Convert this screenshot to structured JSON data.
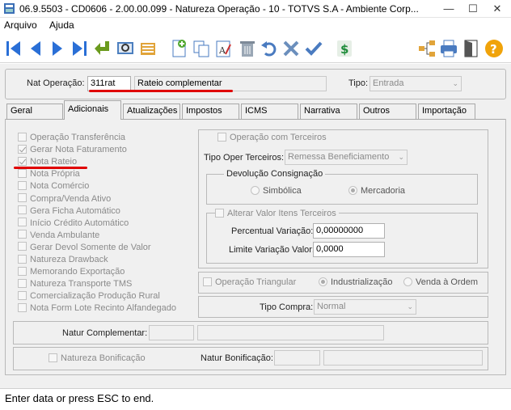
{
  "window": {
    "title": "06.9.5503 - CD0606 - 2.00.00.099 - Natureza Operação - 10 - TOTVS S.A - Ambiente Corp...",
    "minimize": "—",
    "maximize": "☐",
    "close": "✕"
  },
  "menu": {
    "items": [
      "Arquivo",
      "Ajuda"
    ]
  },
  "toolbar": {
    "icons": [
      "first-icon",
      "prev-icon",
      "next-icon",
      "last-icon",
      "goto-icon",
      "search-icon",
      "list-icon",
      "add-icon",
      "copy-icon",
      "edit-icon",
      "delete-icon",
      "undo-icon",
      "cancel-icon",
      "confirm-icon",
      "dollar-icon",
      "hierarchy-icon",
      "print-icon",
      "exit-icon",
      "help-icon"
    ]
  },
  "header": {
    "nat_label": "Nat Operação:",
    "nat_code": "311rat",
    "nat_desc": "Rateio complementar",
    "tipo_label": "Tipo:",
    "tipo_value": "Entrada"
  },
  "tabs": [
    "Geral",
    "Adicionais",
    "Atualizações",
    "Impostos",
    "ICMS",
    "Narrativa",
    "Outros",
    "Importação"
  ],
  "adicionais": {
    "checkboxes": [
      {
        "label": "Operação Transferência",
        "checked": false
      },
      {
        "label": "Gerar Nota Faturamento",
        "checked": true
      },
      {
        "label": "Nota Rateio",
        "checked": true
      },
      {
        "label": "Nota Própria",
        "checked": false
      },
      {
        "label": "Nota Comércio",
        "checked": false
      },
      {
        "label": "Compra/Venda Ativo",
        "checked": false
      },
      {
        "label": "Gera Ficha Automático",
        "checked": false
      },
      {
        "label": "Início Crédito Automático",
        "checked": false
      },
      {
        "label": "Venda Ambulante",
        "checked": false
      },
      {
        "label": "Gerar Devol Somente de Valor",
        "checked": false
      },
      {
        "label": "Natureza Drawback",
        "checked": false
      },
      {
        "label": "Memorando Exportação",
        "checked": false
      },
      {
        "label": "Natureza Transporte TMS",
        "checked": false
      },
      {
        "label": "Comercialização Produção Rural",
        "checked": false
      },
      {
        "label": "Nota Form Lote Recinto Alfandegado",
        "checked": false
      }
    ],
    "terceiros": {
      "op_label": "Operação com Terceiros",
      "tipo_label": "Tipo Oper Terceiros:",
      "tipo_value": "Remessa Beneficiamento",
      "devolucao_title": "Devolução Consignação",
      "simbolica": "Simbólica",
      "mercadoria": "Mercadoria",
      "alterar_label": "Alterar Valor Itens Terceiros",
      "percentual_label": "Percentual Variação:",
      "percentual_value": "0,00000000",
      "limite_label": "Limite Variação Valor:",
      "limite_value": "0,0000"
    },
    "triangular": {
      "label": "Operação Triangular",
      "industrializacao": "Industrialização",
      "venda_ordem": "Venda à Ordem"
    },
    "tipo_compra_label": "Tipo Compra:",
    "tipo_compra_value": "Normal",
    "natur_complementar_label": "Natur Complementar:",
    "natur_bonif_check_label": "Natureza Bonificação",
    "natur_bonif_label": "Natur Bonificação:"
  },
  "status": "Enter data or press ESC to end.",
  "colors": {
    "accent_red": "#e00000",
    "background": "#f0f0f0"
  }
}
